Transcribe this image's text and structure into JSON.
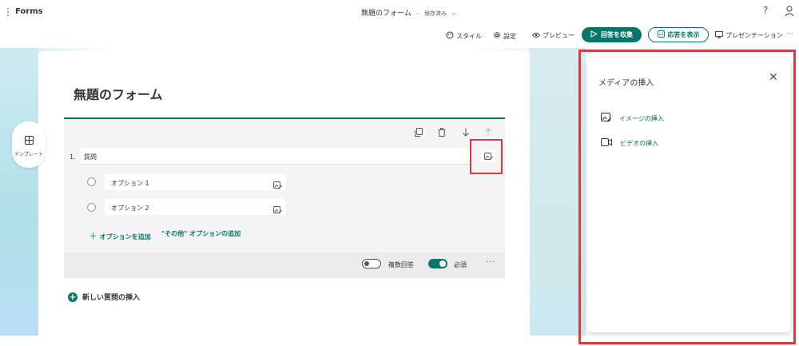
{
  "app": {
    "name": "Forms",
    "menu_glyph": "⋮"
  },
  "doc": {
    "title": "無題のフォーム",
    "separator": "-",
    "saved": "保存済み"
  },
  "header": {
    "help_glyph": "?"
  },
  "toolbar": {
    "style": "スタイル",
    "settings": "設定",
    "preview": "プレビュー",
    "collect": "回答を収集",
    "responses": "応答を表示",
    "present": "プレゼンテーション",
    "more": "···"
  },
  "sidebar": {
    "template_label": "テンプレート"
  },
  "form": {
    "title": "無題のフォーム",
    "question": {
      "number": "1.",
      "text": "質問",
      "options": [
        "オプション 1",
        "オプション 2"
      ],
      "add_option": "オプションを追加",
      "add_other": "\"その他\" オプションの追加",
      "multiple_answers": "複数回答",
      "required": "必須",
      "more": "···"
    },
    "new_question": "新しい質問の挿入"
  },
  "panel": {
    "title": "メディアの挿入",
    "items": [
      "イメージの挿入",
      "ビデオの挿入"
    ]
  },
  "colors": {
    "accent": "#077568",
    "highlight": "#d83b3b"
  }
}
